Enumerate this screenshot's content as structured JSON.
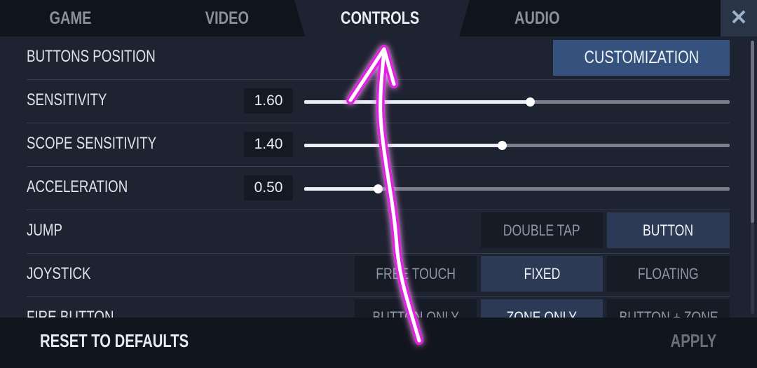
{
  "tabs": {
    "game": "GAME",
    "video": "VIDEO",
    "controls": "CONTROLS",
    "audio": "AUDIO",
    "close": "✕"
  },
  "rows": {
    "buttons_position": {
      "label": "BUTTONS POSITION",
      "button": "CUSTOMIZATION"
    },
    "sensitivity": {
      "label": "SENSITIVITY",
      "value": "1.60",
      "fraction": 0.53
    },
    "scope_sensitivity": {
      "label": "SCOPE SENSITIVITY",
      "value": "1.40",
      "fraction": 0.465
    },
    "acceleration": {
      "label": "ACCELERATION",
      "value": "0.50",
      "fraction": 0.173
    },
    "jump": {
      "label": "JUMP",
      "options": [
        "DOUBLE TAP",
        "BUTTON"
      ],
      "selected": "BUTTON"
    },
    "joystick": {
      "label": "JOYSTICK",
      "options": [
        "FREE TOUCH",
        "FIXED",
        "FLOATING"
      ],
      "selected": "FIXED"
    },
    "fire_button": {
      "label": "FIRE BUTTON",
      "options": [
        "BUTTON ONLY",
        "ZONE ONLY",
        "BUTTON + ZONE"
      ],
      "selected": "ZONE ONLY"
    }
  },
  "footer": {
    "reset": "RESET TO DEFAULTS",
    "apply": "APPLY"
  },
  "colors": {
    "accent": "#34527d",
    "annotation": "#e020e0"
  }
}
